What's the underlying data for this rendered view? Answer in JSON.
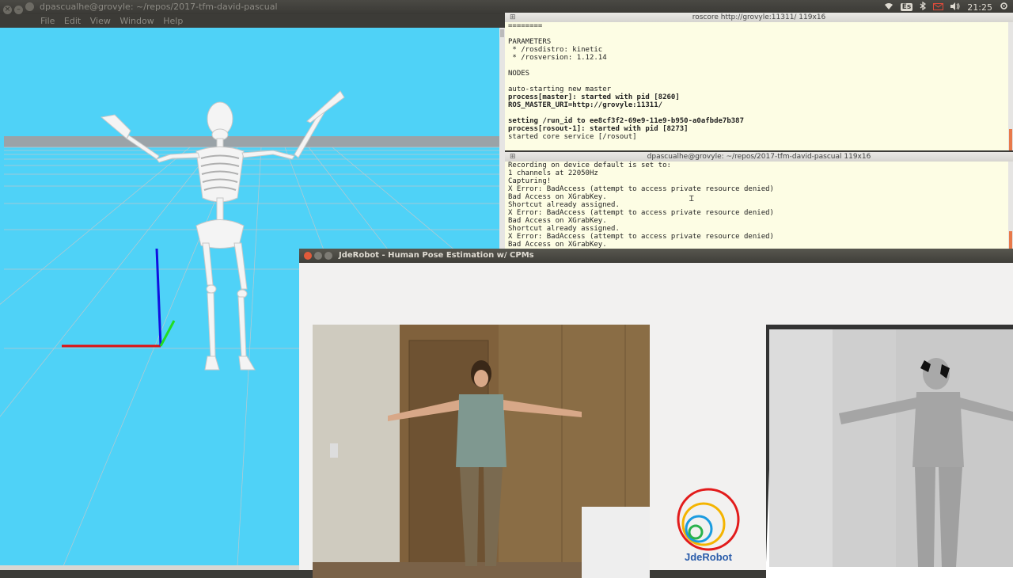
{
  "topbar": {
    "window_title": "dpascualhe@grovyle: ~/repos/2017-tfm-david-pascual",
    "keyboard_layout": "Es",
    "clock": "21:25",
    "icons": [
      "wifi-icon",
      "bluetooth-icon",
      "keyboard-icon",
      "mail-icon",
      "volume-icon",
      "settings-icon"
    ]
  },
  "menubar": {
    "items": [
      "File",
      "Edit",
      "View",
      "Window",
      "Help"
    ]
  },
  "terminal_top": {
    "title": "roscore http://grovyle:11311/ 119x16",
    "lines": [
      {
        "text": "========",
        "bold": false
      },
      {
        "text": "",
        "bold": false
      },
      {
        "text": "PARAMETERS",
        "bold": false
      },
      {
        "text": " * /rosdistro: kinetic",
        "bold": false
      },
      {
        "text": " * /rosversion: 1.12.14",
        "bold": false
      },
      {
        "text": "",
        "bold": false
      },
      {
        "text": "NODES",
        "bold": false
      },
      {
        "text": "",
        "bold": false
      },
      {
        "text": "auto-starting new master",
        "bold": false
      },
      {
        "text": "process[master]: started with pid [8260]",
        "bold": true
      },
      {
        "text": "ROS_MASTER_URI=http://grovyle:11311/",
        "bold": true
      },
      {
        "text": "",
        "bold": false
      },
      {
        "text": "setting /run_id to ee8cf3f2-69e9-11e9-b950-a0afbde7b387",
        "bold": true
      },
      {
        "text": "process[rosout-1]: started with pid [8273]",
        "bold": true
      },
      {
        "text": "started core service [/rosout]",
        "bold": false
      }
    ]
  },
  "terminal_bottom": {
    "title": "dpascualhe@grovyle: ~/repos/2017-tfm-david-pascual 119x16",
    "lines": [
      "Recording on device default is set to:",
      "1 channels at 22050Hz",
      "Capturing!",
      "X Error: BadAccess (attempt to access private resource denied)",
      "Bad Access on XGrabKey.",
      "Shortcut already assigned.",
      "X Error: BadAccess (attempt to access private resource denied)",
      "Bad Access on XGrabKey.",
      "Shortcut already assigned.",
      "X Error: BadAccess (attempt to access private resource denied)",
      "Bad Access on XGrabKey."
    ]
  },
  "app": {
    "title": "JdeRobot - Human Pose Estimation w/ CPMs",
    "logo_text": "JdeRobot"
  },
  "colors": {
    "viewer_bg": "#4fd2f7",
    "terminal_bg": "#fdfde4",
    "axis_x": "#e01010",
    "axis_y": "#22dd22",
    "axis_z": "#1010e0",
    "logo_blue": "#2a5caa"
  }
}
